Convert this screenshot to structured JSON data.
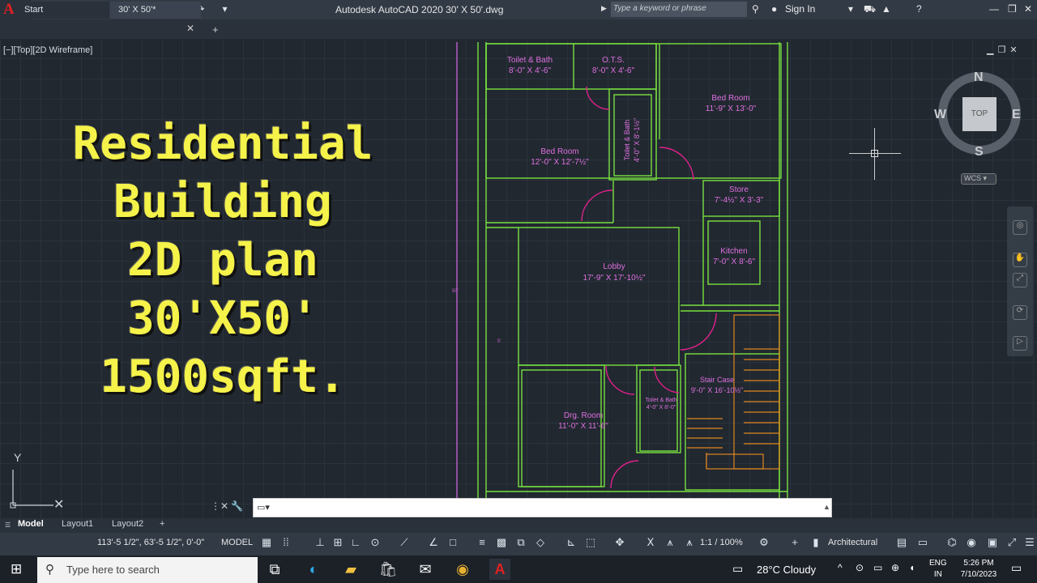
{
  "app": {
    "title": "Autodesk AutoCAD 2020    30' X 50'.dwg",
    "search_placeholder": "Type a keyword or phrase",
    "sign_in": "Sign In",
    "logo": "A"
  },
  "tabs": [
    {
      "label": "Start"
    },
    {
      "label": "30' X 50'*"
    }
  ],
  "viewport": {
    "label": "[−][Top][2D Wireframe]"
  },
  "overlay_title": [
    "Residential",
    "Building",
    "2D plan",
    "30'X50'",
    "1500sqft."
  ],
  "navigation": {
    "cube_label": "TOP",
    "north": "N",
    "south": "S",
    "east": "E",
    "west": "W",
    "wcs": "WCS"
  },
  "ucs": {
    "y": "Y"
  },
  "drawing": {
    "rooms": [
      {
        "name": "Toilet & Bath",
        "size": "8'-0\" X 4'-6\""
      },
      {
        "name": "O.T.S.",
        "size": "8'-0\" X 4'-6\""
      },
      {
        "name": "Bed Room",
        "size": "11'-9\" X 13'-0\""
      },
      {
        "name": "Toilet & Bath",
        "size": "4'-0\" X 8'-1½\""
      },
      {
        "name": "Bed Room",
        "size": "12'-0\" X 12'-7½\""
      },
      {
        "name": "Store",
        "size": "7'-4½\" X 3'-3\""
      },
      {
        "name": "Kitchen",
        "size": "7'-0\" X 8'-6\""
      },
      {
        "name": "Lobby",
        "size": "17'-9\" X 17'-10½\""
      },
      {
        "name": "Stair Case",
        "size": "9'-0\" X 16'-10½\""
      },
      {
        "name": "Toilet & Bath",
        "size": "4'-0\" X 8'-0\""
      },
      {
        "name": "Drg. Room",
        "size": "11'-0\" X 11'-6\""
      }
    ],
    "dim_side": "50'",
    "dim_left": "5'"
  },
  "layout_tabs": [
    {
      "label": "Model"
    },
    {
      "label": "Layout1"
    },
    {
      "label": "Layout2"
    }
  ],
  "status": {
    "coords": "113'-5 1/2\", 63'-5 1/2\", 0'-0\"",
    "model": "MODEL",
    "scale": "1:1 / 100%",
    "units": "Architectural"
  },
  "taskbar": {
    "search": "Type here to search",
    "weather": "28°C  Cloudy",
    "lang": [
      "ENG",
      "IN"
    ],
    "time": "5:26 PM",
    "date": "7/10/2023"
  },
  "colors": {
    "wall": "#78e040",
    "text": "#e070e0",
    "door": "#e0208a",
    "stair": "#e0851f",
    "title": "#f5f24a"
  }
}
